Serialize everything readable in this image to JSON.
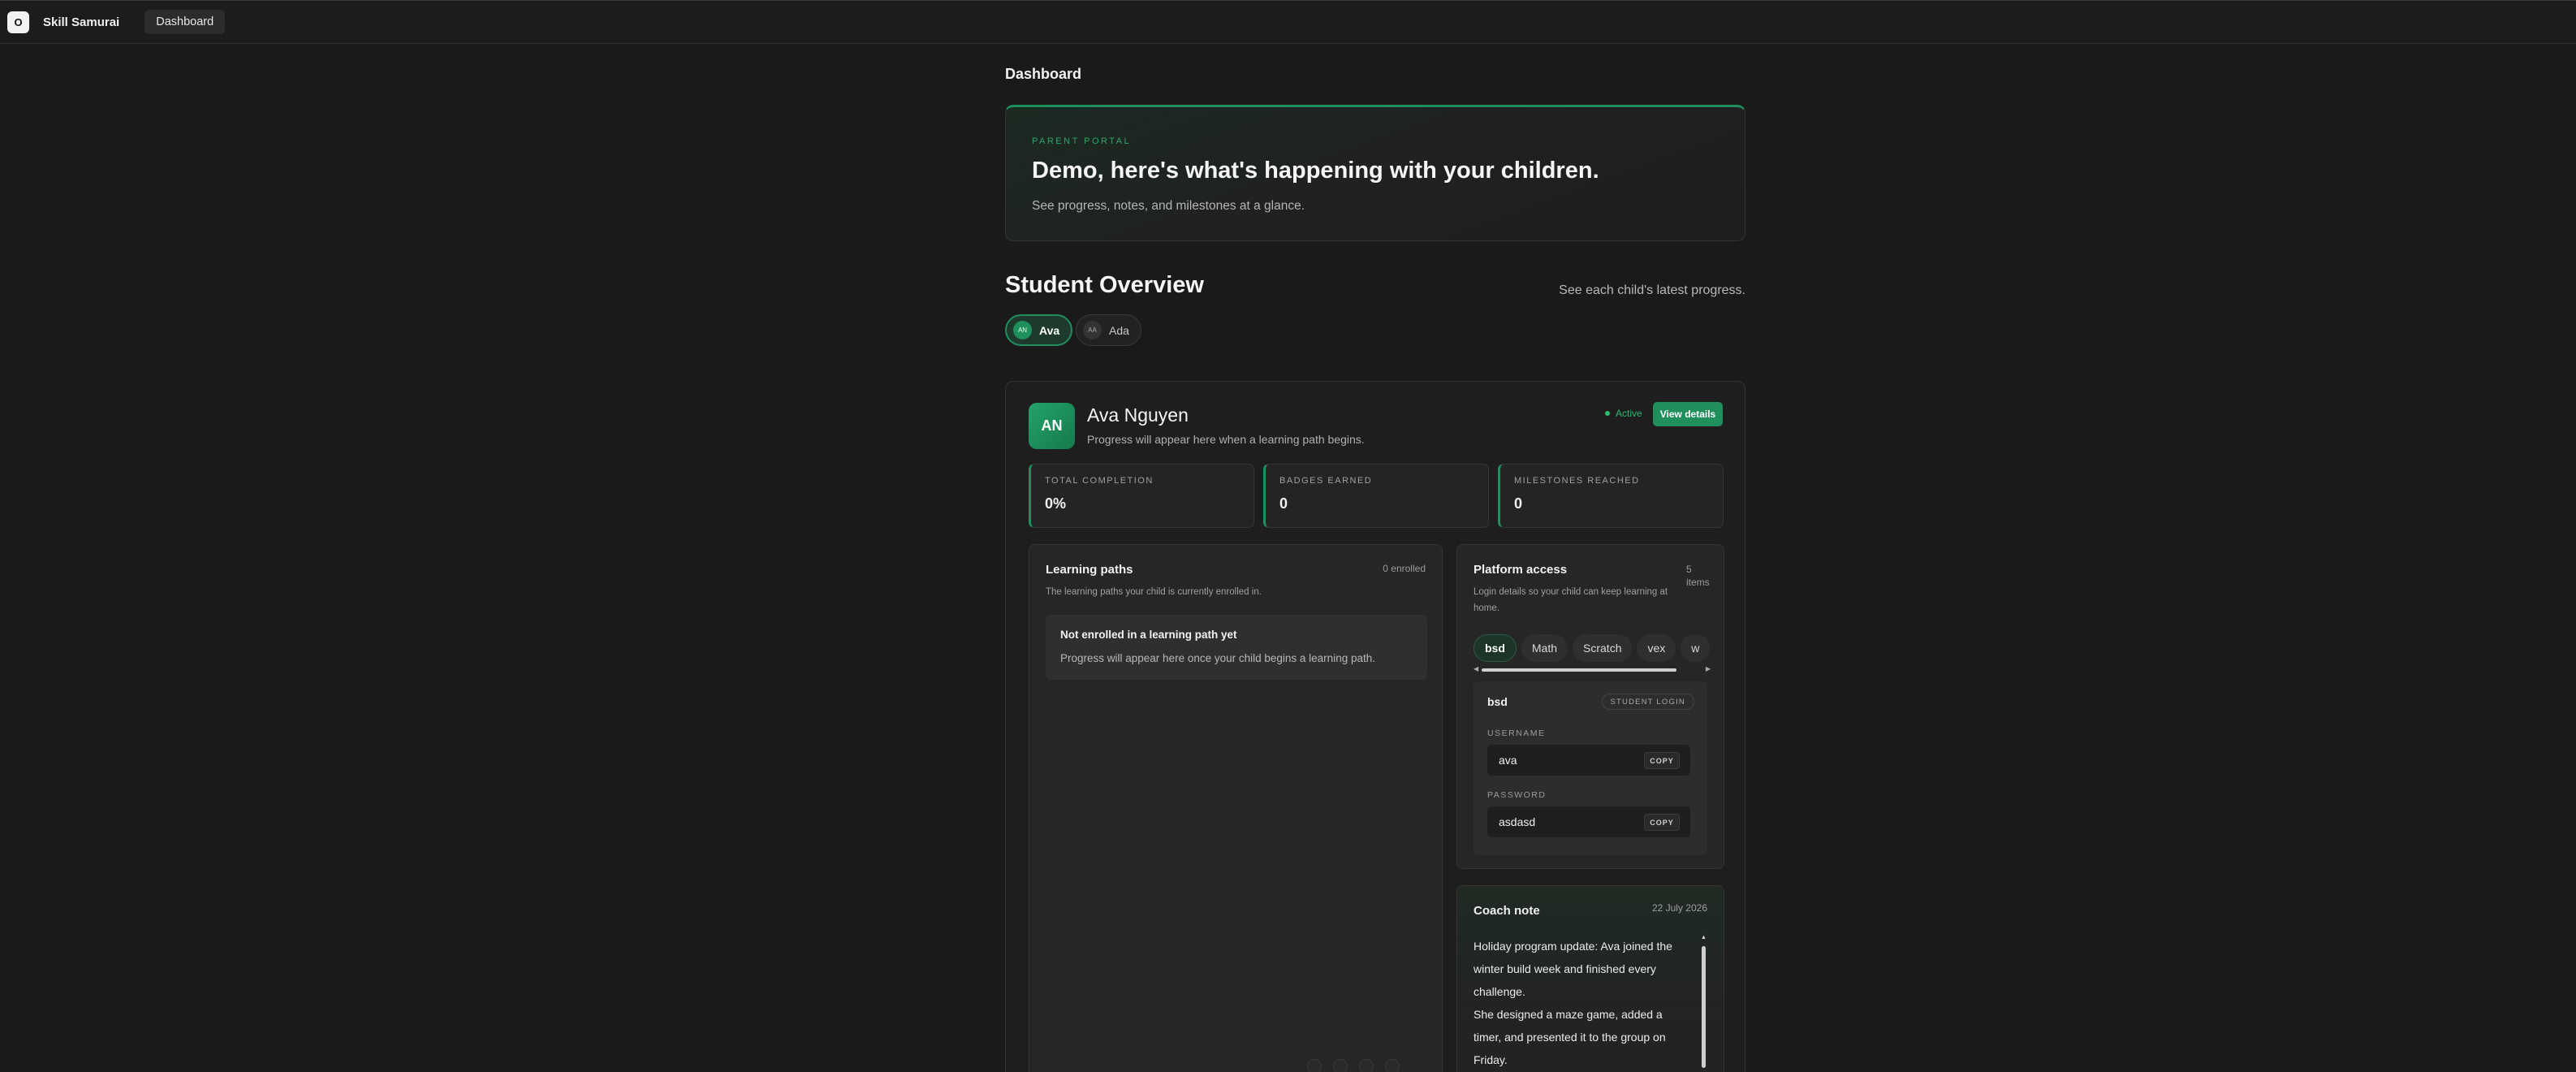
{
  "header": {
    "logo_letter": "O",
    "brand": "Skill Samurai",
    "nav_tab": "Dashboard"
  },
  "page": {
    "title": "Dashboard"
  },
  "hero": {
    "eyebrow": "PARENT PORTAL",
    "heading": "Demo, here's what's happening with your children.",
    "subtitle": "See progress, notes, and milestones at a glance."
  },
  "overview": {
    "title": "Student Overview",
    "hint": "See each child's latest progress.",
    "children": [
      {
        "initials": "AN",
        "name": "Ava",
        "selected": true
      },
      {
        "initials": "AA",
        "name": "Ada",
        "selected": false
      }
    ]
  },
  "student": {
    "initials": "AN",
    "name": "Ava Nguyen",
    "subtitle": "Progress will appear here when a learning path begins.",
    "status": "Active",
    "view_button": "View details",
    "stats": [
      {
        "label": "TOTAL COMPLETION",
        "value": "0%"
      },
      {
        "label": "BADGES EARNED",
        "value": "0"
      },
      {
        "label": "MILESTONES REACHED",
        "value": "0"
      }
    ]
  },
  "learning_paths": {
    "title": "Learning paths",
    "count": "0 enrolled",
    "description": "The learning paths your child is currently enrolled in.",
    "empty_title": "Not enrolled in a learning path yet",
    "empty_text": "Progress will appear here once your child begins a learning path."
  },
  "platform_access": {
    "title": "Platform access",
    "count": "5 items",
    "description": "Login details so your child can keep learning at home.",
    "tabs": [
      "bsd",
      "Math",
      "Scratch",
      "vex",
      "w"
    ],
    "active_tab": "bsd",
    "login": {
      "name": "bsd",
      "badge": "STUDENT LOGIN",
      "username_label": "USERNAME",
      "username": "ava",
      "password_label": "PASSWORD",
      "password": "asdasd",
      "copy_label": "COPY"
    }
  },
  "coach_note": {
    "title": "Coach note",
    "date": "22 July 2026",
    "paragraphs": [
      "Holiday program update: Ava joined the winter build week and finished every challenge.",
      "She designed a maze game, added a timer, and presented it to the group on Friday."
    ]
  },
  "colors": {
    "accent": "#1f8f5c",
    "background": "#1a1a1a",
    "card": "#1e1e1e"
  }
}
